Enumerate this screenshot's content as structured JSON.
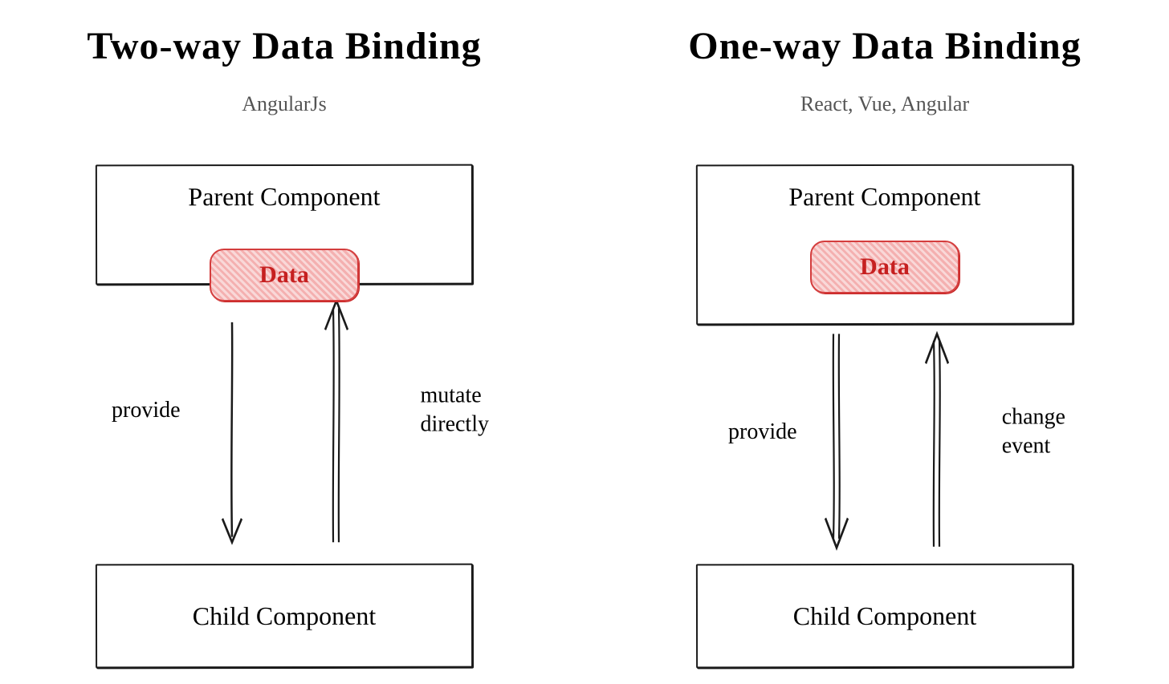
{
  "left": {
    "title": "Two-way Data Binding",
    "subtitle": "AngularJs",
    "parent_label": "Parent Component",
    "data_label": "Data",
    "child_label": "Child Component",
    "arrow_down_label": "provide",
    "arrow_up_label": "mutate\ndirectly"
  },
  "right": {
    "title": "One-way Data Binding",
    "subtitle": "React, Vue, Angular",
    "parent_label": "Parent Component",
    "data_label": "Data",
    "child_label": "Child Component",
    "arrow_down_label": "provide",
    "arrow_up_label": "change\nevent"
  },
  "colors": {
    "data_fill": "#f9d8d8",
    "data_border": "#d43d3d",
    "data_text": "#c62020",
    "box_border": "#1a1a1a"
  }
}
